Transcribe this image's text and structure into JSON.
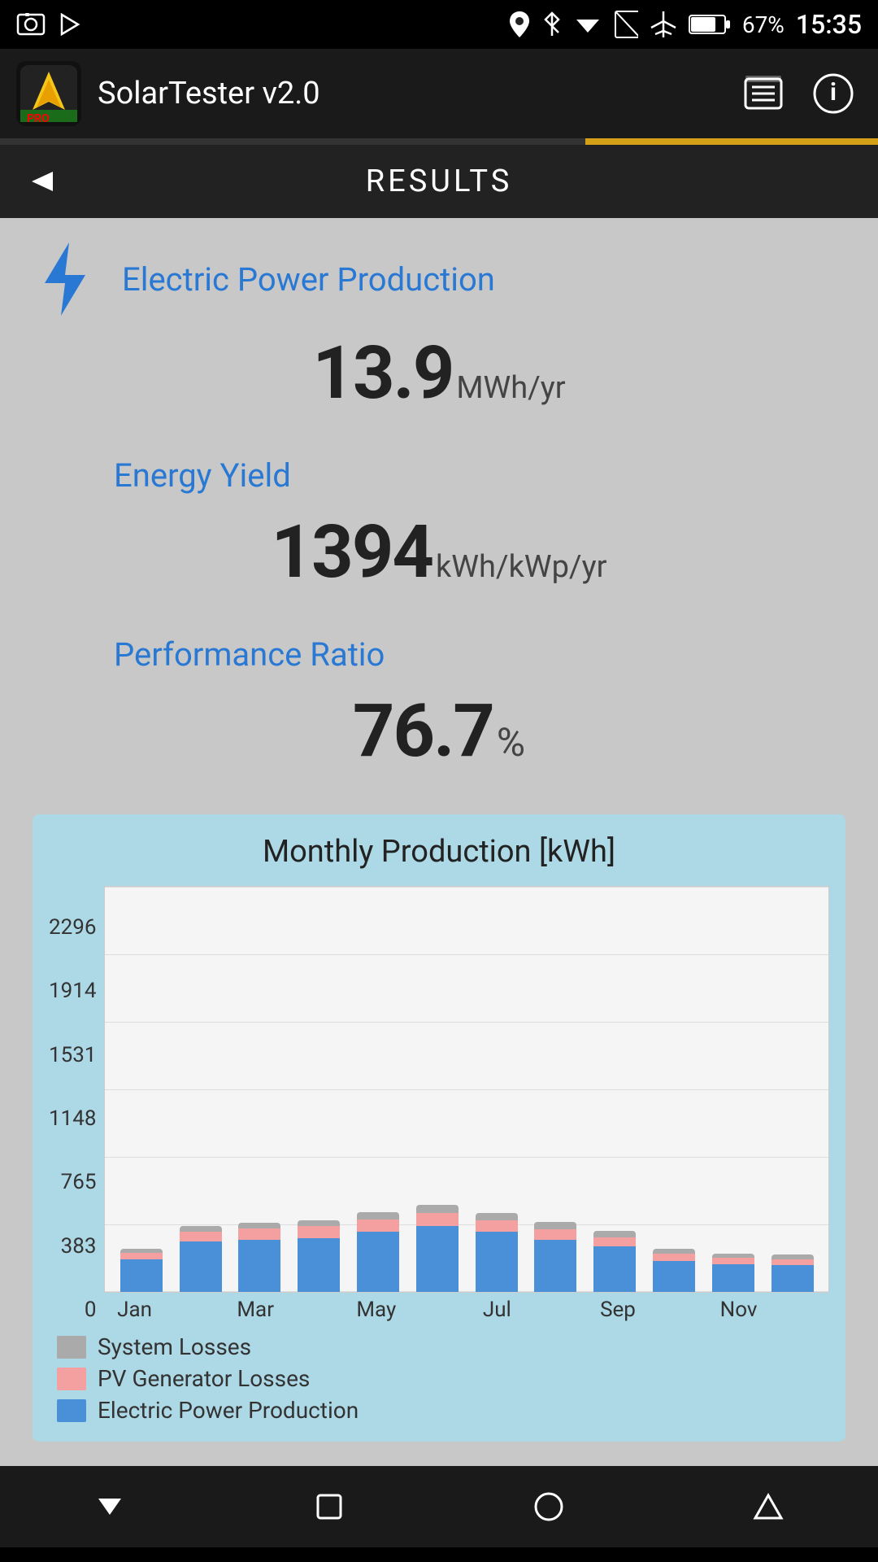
{
  "statusBar": {
    "time": "15:35",
    "battery": "67%"
  },
  "appBar": {
    "title": "SolarTester v2.0",
    "appIconEmoji": "⚡"
  },
  "toolbar": {
    "title": "RESULTS"
  },
  "metrics": {
    "electricPowerProduction": {
      "label": "Electric Power Production",
      "value": "13.9",
      "unit": "MWh/yr"
    },
    "energyYield": {
      "label": "Energy Yield",
      "value": "1394",
      "unit": "kWh/kWp/yr"
    },
    "performanceRatio": {
      "label": "Performance Ratio",
      "value": "76.7",
      "unit": "%"
    }
  },
  "chart": {
    "title": "Monthly Production [kWh]",
    "yLabels": [
      "2296",
      "1914",
      "1531",
      "1148",
      "765",
      "383",
      "0"
    ],
    "xLabels": [
      "Jan",
      "Mar",
      "May",
      "Jul",
      "Sep",
      "Nov"
    ],
    "bars": [
      {
        "elec": 185,
        "pv": 35,
        "losses": 22
      },
      {
        "elec": 285,
        "pv": 55,
        "losses": 30
      },
      {
        "elec": 295,
        "pv": 65,
        "losses": 32
      },
      {
        "elec": 305,
        "pv": 65,
        "losses": 36
      },
      {
        "elec": 340,
        "pv": 70,
        "losses": 40
      },
      {
        "elec": 370,
        "pv": 75,
        "losses": 45
      },
      {
        "elec": 340,
        "pv": 65,
        "losses": 42
      },
      {
        "elec": 295,
        "pv": 60,
        "losses": 38
      },
      {
        "elec": 255,
        "pv": 55,
        "losses": 35
      },
      {
        "elec": 175,
        "pv": 40,
        "losses": 28
      },
      {
        "elec": 155,
        "pv": 38,
        "losses": 25
      },
      {
        "elec": 150,
        "pv": 36,
        "losses": 24
      }
    ],
    "legend": [
      {
        "color": "#aaa",
        "label": "System Losses"
      },
      {
        "color": "#f4a0a0",
        "label": "PV Generator Losses"
      },
      {
        "color": "#4a90d9",
        "label": "Electric Power Production"
      }
    ]
  },
  "navbar": {
    "backLabel": "▼",
    "homeLabel": "□",
    "circleLabel": "○",
    "triangleLabel": "△"
  }
}
